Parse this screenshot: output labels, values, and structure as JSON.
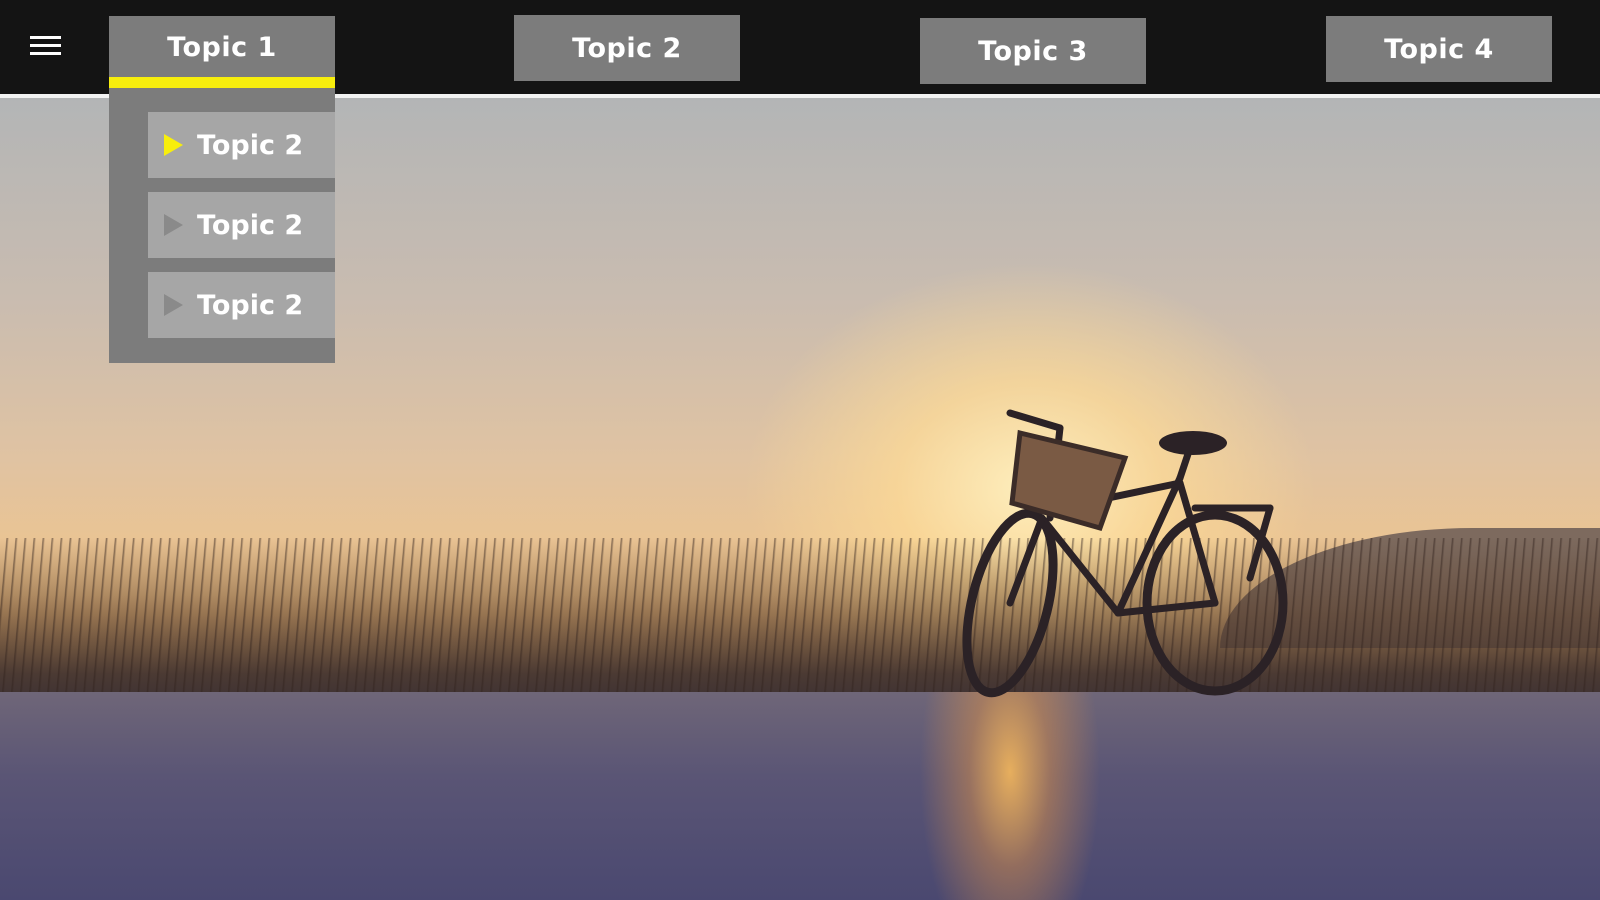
{
  "nav": {
    "tabs": [
      {
        "label": "Topic 1",
        "active": true
      },
      {
        "label": "Topic 2",
        "active": false
      },
      {
        "label": "Topic 3",
        "active": false
      },
      {
        "label": "Topic 4",
        "active": false
      }
    ],
    "dropdown": {
      "items": [
        {
          "label": "Topic 2",
          "active": true
        },
        {
          "label": "Topic 2",
          "active": false
        },
        {
          "label": "Topic 2",
          "active": false
        }
      ]
    }
  },
  "colors": {
    "bar_bg": "#141414",
    "tab_bg": "#7c7c7c",
    "dropdown_item_bg": "#a6a6a6",
    "accent": "#f7ee0d",
    "text": "#ffffff"
  },
  "icons": {
    "menu": "hamburger-menu-icon",
    "item_marker": "triangle-right-icon"
  },
  "background": {
    "subject": "bicycle silhouette at sunset on a road with tall grass"
  }
}
